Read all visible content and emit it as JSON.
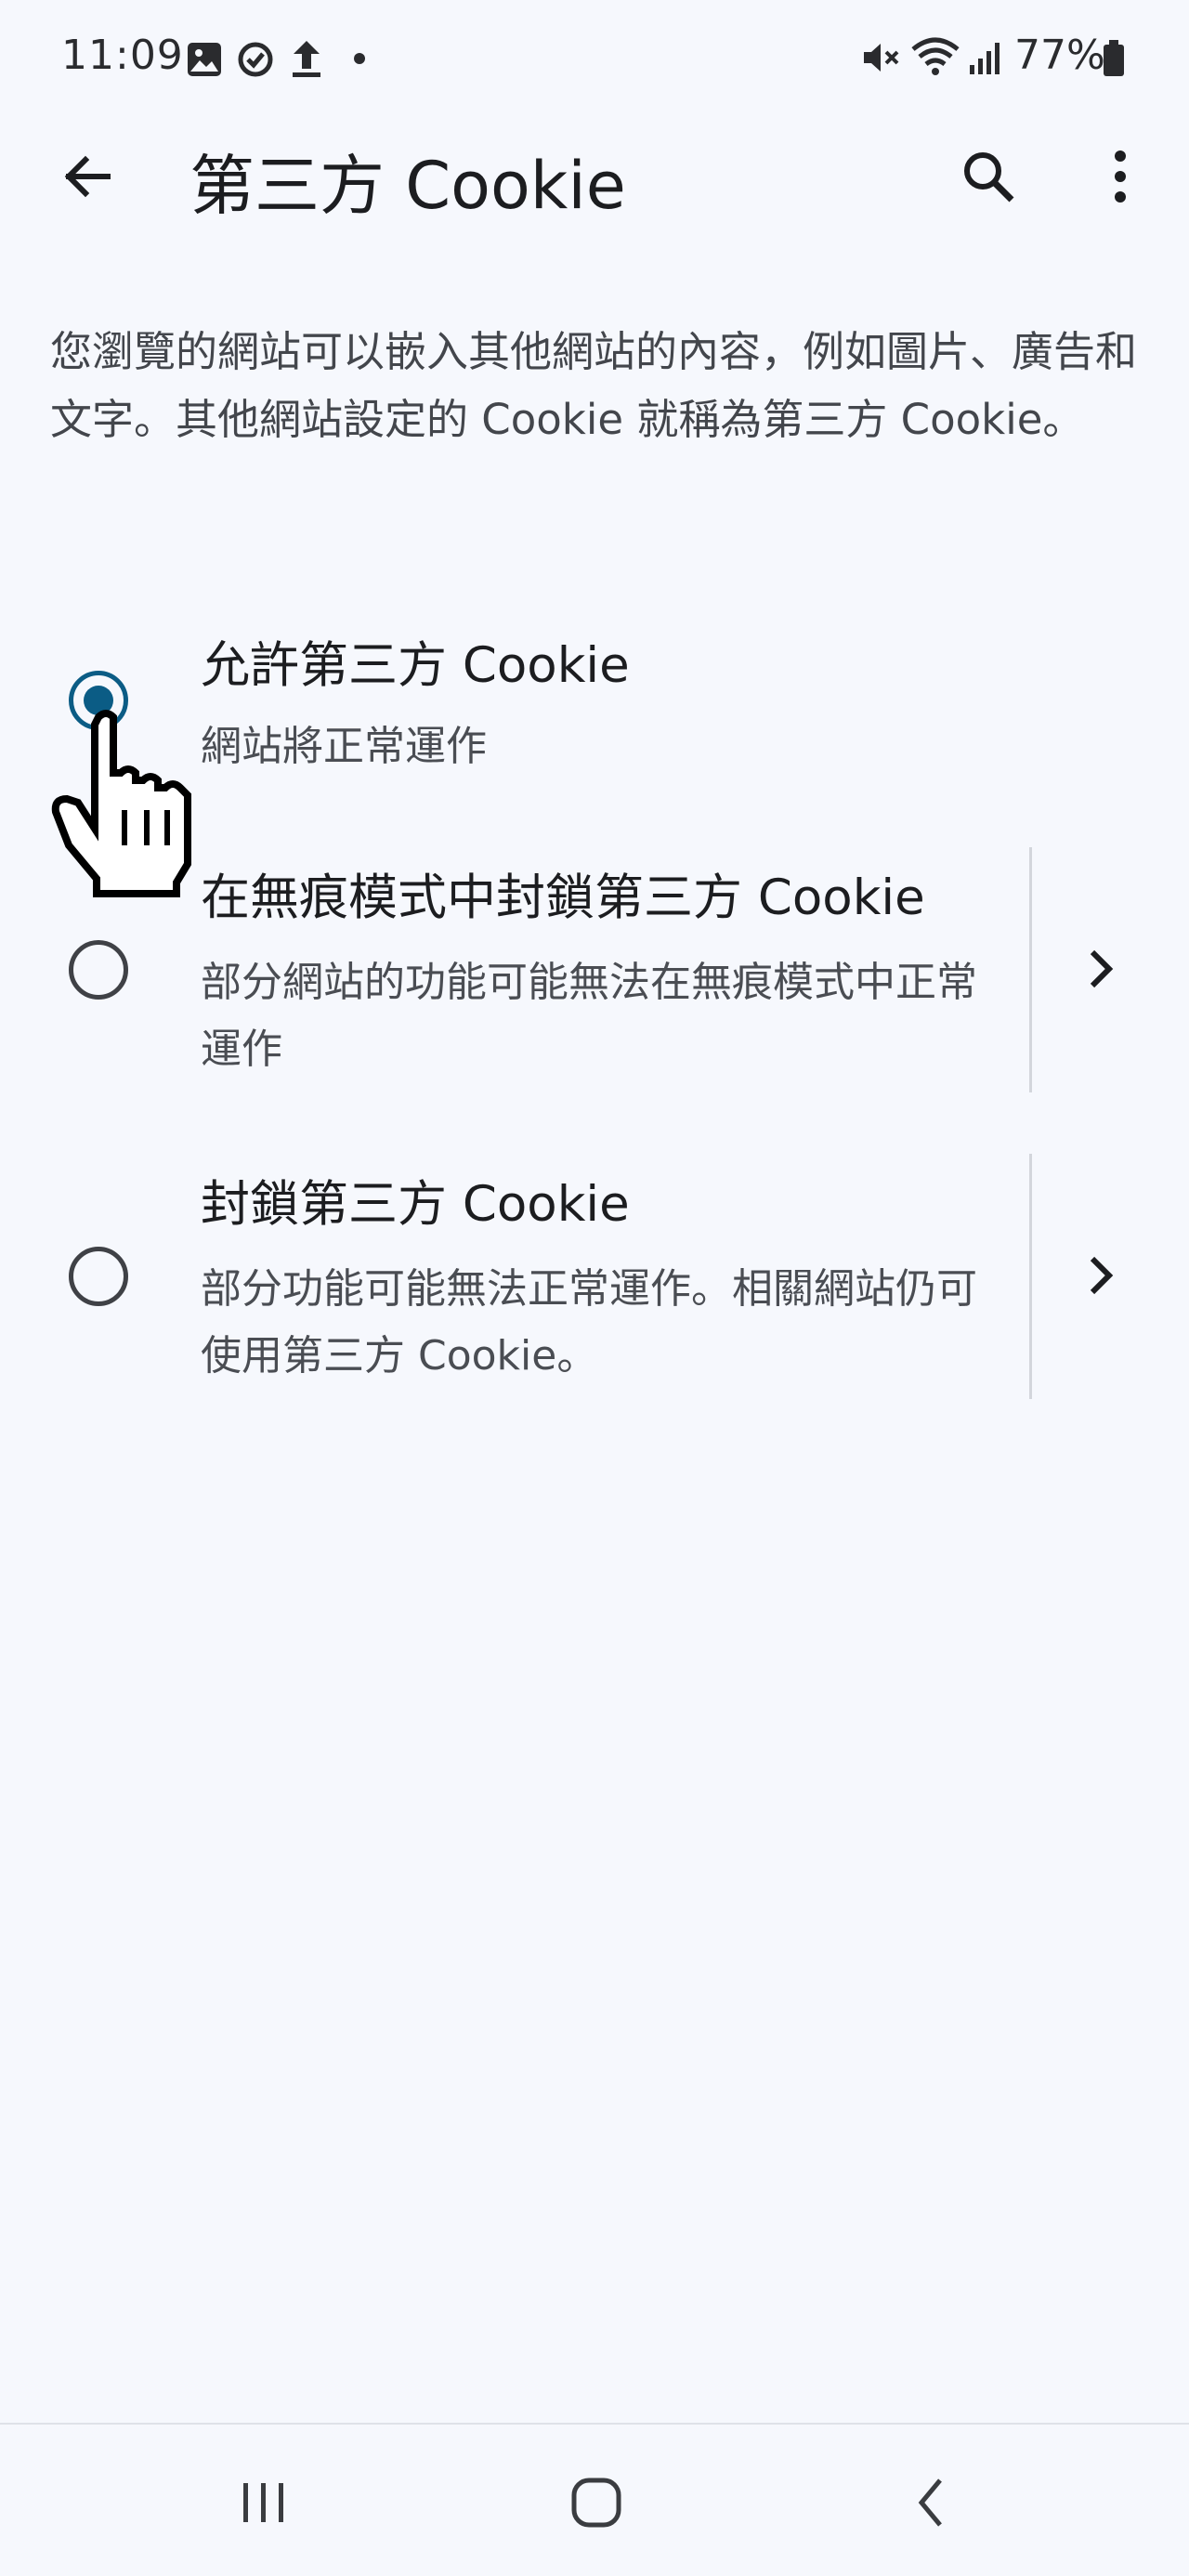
{
  "status_bar": {
    "time": "11:09",
    "battery_percent": "77%",
    "icons": [
      "gallery-icon",
      "sync-icon",
      "upload-icon",
      "dot-icon",
      "mute-icon",
      "wifi-icon",
      "signal-icon",
      "battery-icon"
    ]
  },
  "app_bar": {
    "title": "第三方 Cookie",
    "back_icon": "arrow-left-icon",
    "search_icon": "search-icon",
    "more_icon": "more-vert-icon"
  },
  "description": "您瀏覽的網站可以嵌入其他網站的內容，例如圖片、廣告和文字。其他網站設定的 Cookie 就稱為第三方 Cookie。",
  "options": [
    {
      "title": "允許第三方 Cookie",
      "subtitle": "網站將正常運作",
      "selected": true,
      "has_details": false
    },
    {
      "title": "在無痕模式中封鎖第三方 Cookie",
      "subtitle": "部分網站的功能可能無法在無痕模式中正常運作",
      "selected": false,
      "has_details": true
    },
    {
      "title": "封鎖第三方 Cookie",
      "subtitle": "部分功能可能無法正常運作。相關網站仍可使用第三方 Cookie。",
      "selected": false,
      "has_details": true
    }
  ],
  "nav_bar": {
    "recents_icon": "recents-icon",
    "home_icon": "home-icon",
    "back_icon": "nav-back-icon"
  },
  "colors": {
    "background": "#f6f8fd",
    "accent": "#0b5c85",
    "text_primary": "#1c1d20",
    "text_secondary": "#4a4d53"
  }
}
